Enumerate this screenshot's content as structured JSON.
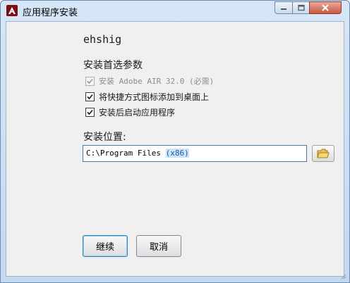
{
  "window": {
    "title": "应用程序安装"
  },
  "content": {
    "publisher": "ehshig",
    "preferences_label": "安装首选参数",
    "options": [
      {
        "label": "安装 Adobe AIR 32.0 (必需)",
        "checked": true,
        "disabled": true
      },
      {
        "label": "将快捷方式图标添加到桌面上",
        "checked": true,
        "disabled": false
      },
      {
        "label": "安装后启动应用程序",
        "checked": true,
        "disabled": false
      }
    ],
    "location_label": "安装位置:",
    "location_value_prefix": "C:\\Program Files ",
    "location_value_selected": "(x86)",
    "buttons": {
      "continue": "继续",
      "cancel": "取消"
    }
  },
  "icons": [
    "adobe-air-icon",
    "minimize-icon",
    "maximize-icon",
    "close-icon",
    "checkmark-icon",
    "folder-icon"
  ]
}
